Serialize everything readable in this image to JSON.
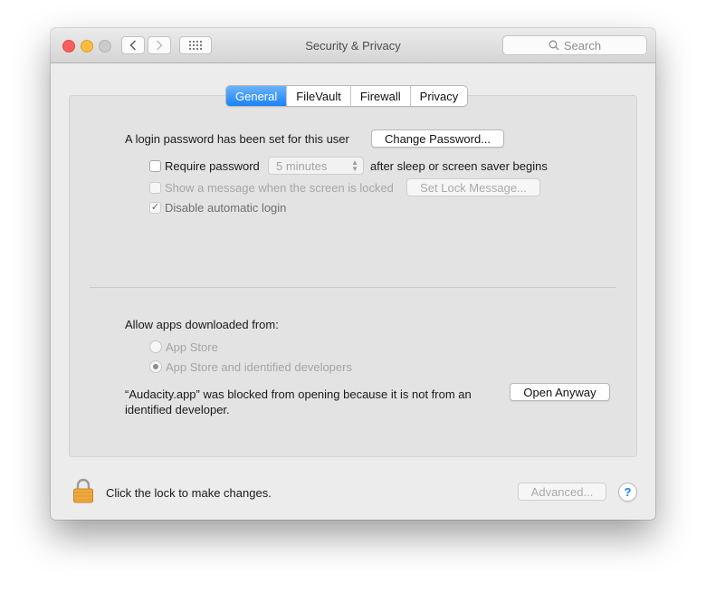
{
  "window": {
    "title": "Security & Privacy"
  },
  "toolbar": {
    "back_icon": "chevron-left-icon",
    "forward_icon": "chevron-right-icon",
    "show_all_icon": "grid-icon",
    "search_placeholder": "Search"
  },
  "tabs": [
    {
      "label": "General",
      "selected": true
    },
    {
      "label": "FileVault",
      "selected": false
    },
    {
      "label": "Firewall",
      "selected": false
    },
    {
      "label": "Privacy",
      "selected": false
    }
  ],
  "general": {
    "login_password_text": "A login password has been set for this user",
    "change_password_button": "Change Password...",
    "require_password": {
      "label": "Require password",
      "checked": false,
      "delay_value": "5 minutes",
      "suffix": "after sleep or screen saver begins"
    },
    "show_message": {
      "label": "Show a message when the screen is locked",
      "checked": false,
      "button": "Set Lock Message..."
    },
    "disable_auto_login": {
      "label": "Disable automatic login",
      "checked": true,
      "checkmark": "✓"
    }
  },
  "allow_apps": {
    "heading": "Allow apps downloaded from:",
    "options": [
      {
        "label": "App Store",
        "selected": false
      },
      {
        "label": "App Store and identified developers",
        "selected": true
      }
    ],
    "blocked_line1": "“Audacity.app” was blocked from opening because it is not from an",
    "blocked_line2": "identified developer.",
    "open_anyway_button": "Open Anyway"
  },
  "footer": {
    "lock_text": "Click the lock to make changes.",
    "advanced_button": "Advanced...",
    "help_label": "?"
  },
  "colors": {
    "accent_blue": "#1a82fb",
    "close": "#fc605c",
    "minimize": "#fdbc40",
    "zoom_inactive": "#cbcbcb",
    "lock_gold": "#f0a93a"
  }
}
